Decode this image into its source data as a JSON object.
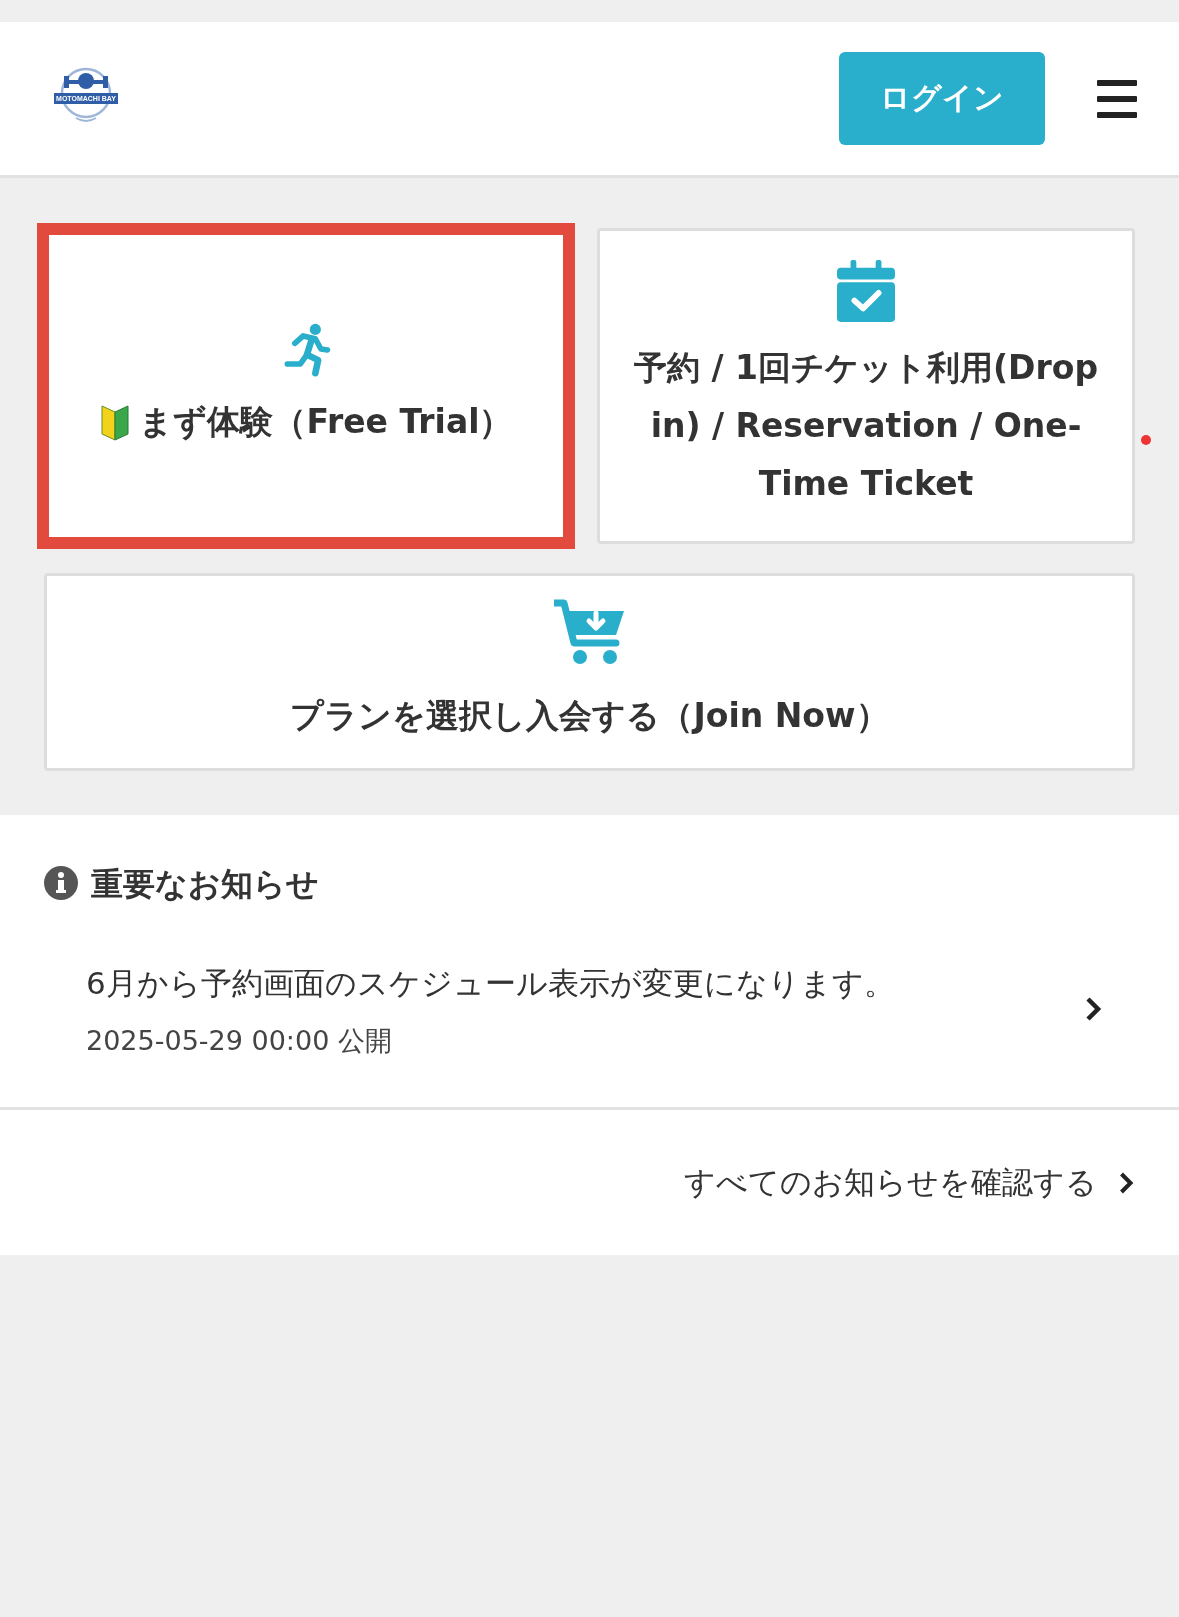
{
  "header": {
    "logo_text": "MOTOMACHI BAY",
    "login_button": "ログイン"
  },
  "cards": [
    {
      "kind": "trial",
      "label": "まず体験（Free Trial）",
      "highlighted": true,
      "dot": false
    },
    {
      "kind": "reserve",
      "label": "予約 / 1回チケット利用(Drop in) / Reservation / One-Time Ticket",
      "highlighted": false,
      "dot": true
    },
    {
      "kind": "join",
      "label": "プランを選択し入会する（Join Now）",
      "highlighted": false,
      "dot": false
    }
  ],
  "notices": {
    "title": "重要なお知らせ",
    "items": [
      {
        "text": "6月から予約画面のスケジュール表示が変更になります。",
        "date": "2025-05-29 00:00 公開"
      }
    ],
    "all_link": "すべてのお知らせを確認する"
  }
}
